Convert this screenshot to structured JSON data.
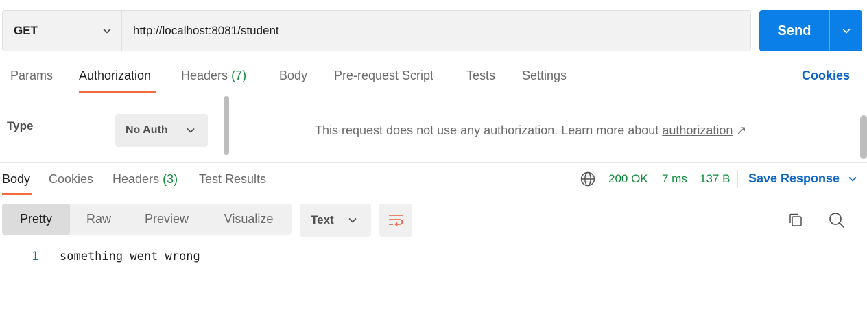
{
  "request": {
    "method": "GET",
    "url": "http://localhost:8081/student",
    "send_label": "Send"
  },
  "request_tabs": {
    "params": "Params",
    "authorization": "Authorization",
    "headers": "Headers",
    "headers_count": "(7)",
    "body": "Body",
    "prerequest": "Pre-request Script",
    "tests": "Tests",
    "settings": "Settings",
    "cookies": "Cookies"
  },
  "auth": {
    "type_label": "Type",
    "type_value": "No Auth",
    "message": "This request does not use any authorization. Learn more about",
    "link_text": "authorization",
    "link_arrow": "↗"
  },
  "response_tabs": {
    "body": "Body",
    "cookies": "Cookies",
    "headers": "Headers",
    "headers_count": "(3)",
    "test_results": "Test Results"
  },
  "response_meta": {
    "status": "200 OK",
    "time": "7 ms",
    "size": "137 B",
    "save_label": "Save Response"
  },
  "view": {
    "modes": [
      "Pretty",
      "Raw",
      "Preview",
      "Visualize"
    ],
    "active_mode": "Pretty",
    "format": "Text"
  },
  "body_lines": [
    {
      "number": "1",
      "text": "something went wrong"
    }
  ],
  "colors": {
    "accent": "#f26b3a",
    "send": "#0a7fe8",
    "link": "#0b63c4",
    "status": "#0f8a3c"
  },
  "icons": {
    "method_dropdown": "chevron-down-icon",
    "send_dropdown": "chevron-down-icon",
    "network": "globe-icon",
    "wrap": "word-wrap-icon",
    "copy": "copy-icon",
    "search": "search-icon"
  }
}
